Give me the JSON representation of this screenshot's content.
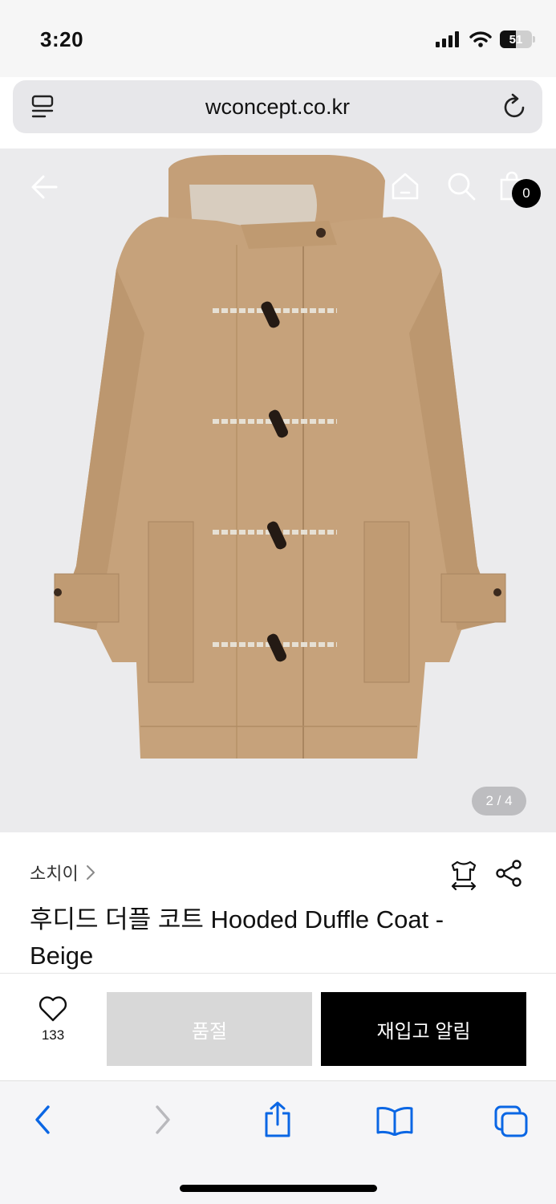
{
  "status_bar": {
    "time": "3:20",
    "battery_level": "51",
    "battery_fraction": 0.51
  },
  "browser": {
    "url": "wconcept.co.kr"
  },
  "header": {
    "cart_count": "0"
  },
  "gallery": {
    "counter": "2 / 4"
  },
  "product": {
    "brand": "소치이",
    "title": "후디드 더플 코트 Hooded Duffle Coat - Beige"
  },
  "actions": {
    "like_count": "133",
    "sold_out_label": "품절",
    "restock_label": "재입고 알림"
  },
  "colors": {
    "accent": "#0a66e4",
    "coat": "#c6a27b",
    "sold_out_bg": "#d8d8d8",
    "primary_button": "#000000"
  }
}
